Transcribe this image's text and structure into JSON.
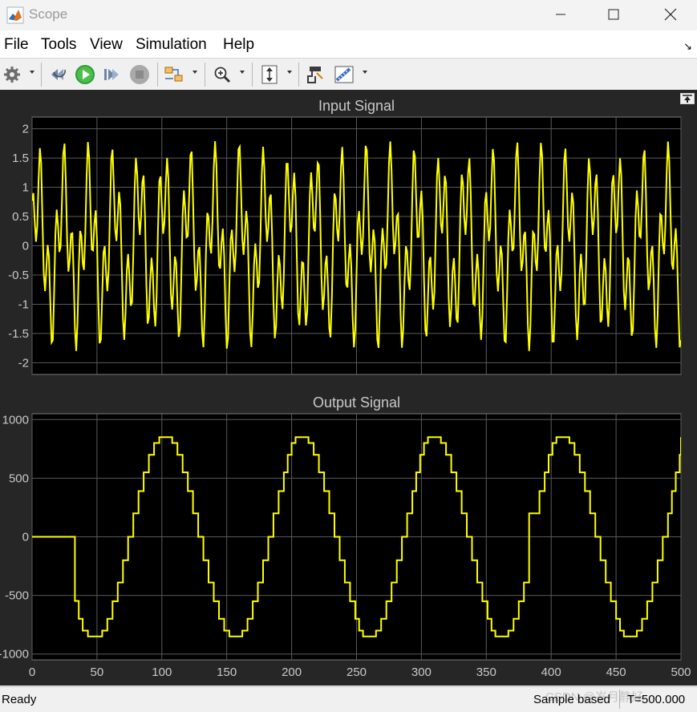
{
  "window": {
    "title": "Scope"
  },
  "menu": {
    "file": "File",
    "tools": "Tools",
    "view": "View",
    "simulation": "Simulation",
    "help": "Help"
  },
  "toolbar": {
    "icons": [
      "gear-icon",
      "step-back-icon",
      "run-icon",
      "step-forward-icon",
      "stop-icon",
      "signal-selector-icon",
      "zoom-icon",
      "autoscale-icon",
      "highlight-block-icon",
      "measurements-icon"
    ]
  },
  "status": {
    "ready": "Ready",
    "mode": "Sample based",
    "time": "T=500.000"
  },
  "watermark": "CSDN @岁月静好",
  "colors": {
    "plot_background": "#000000",
    "figure_background": "#262626",
    "line": "#ffff00",
    "grid": "#5a5a5a",
    "text": "#c8c8c8"
  },
  "chart_data": [
    {
      "type": "line",
      "title": "Input Signal",
      "xlabel": "",
      "ylabel": "",
      "xlim": [
        0,
        500
      ],
      "ylim": [
        -2.2,
        2.2
      ],
      "yticks": [
        -2,
        -1.5,
        -1,
        -0.5,
        0,
        0.5,
        1,
        1.5,
        2
      ],
      "ytick_labels": [
        "-2",
        "-1.5",
        "-1",
        "-0.5",
        "0",
        "0.5",
        "1",
        "1.5",
        "2"
      ],
      "xticks": [
        0,
        50,
        100,
        150,
        200,
        250,
        300,
        350,
        400,
        450,
        500
      ],
      "xtick_labels": [],
      "grid": true,
      "series": [
        {
          "color": "#ffff00",
          "x_start": 0,
          "x_step": 1,
          "x_end": 500,
          "frequencies": [
            0.12,
            0.38
          ],
          "amplitudes": [
            1.0,
            0.8
          ],
          "approx_range": [
            -1.8,
            1.8
          ]
        }
      ]
    },
    {
      "type": "line",
      "title": "Output Signal",
      "xlabel": "",
      "ylabel": "",
      "xlim": [
        0,
        500
      ],
      "ylim": [
        -1050,
        1050
      ],
      "yticks": [
        -1000,
        -500,
        0,
        500,
        1000
      ],
      "ytick_labels": [
        "-1000",
        "-500",
        "0",
        "500",
        "1000"
      ],
      "xticks": [
        0,
        50,
        100,
        150,
        200,
        250,
        300,
        350,
        400,
        450,
        500
      ],
      "xtick_labels": [
        "0",
        "50",
        "100",
        "150",
        "200",
        "250",
        "300",
        "350",
        "400",
        "450",
        "500"
      ],
      "grid": true,
      "series": [
        {
          "color": "#ffff00",
          "points": [
            [
              0,
              0
            ],
            [
              5,
              0
            ],
            [
              33,
              -547
            ],
            [
              36,
              -700
            ],
            [
              39,
              -800
            ],
            [
              43,
              -850
            ],
            [
              50,
              -850
            ],
            [
              54,
              -800
            ],
            [
              58,
              -700
            ],
            [
              62,
              -550
            ],
            [
              66,
              -390
            ],
            [
              70,
              -200
            ],
            [
              74,
              0
            ],
            [
              78,
              200
            ],
            [
              82,
              390
            ],
            [
              86,
              550
            ],
            [
              90,
              700
            ],
            [
              94,
              800
            ],
            [
              98,
              850
            ],
            [
              104,
              850
            ],
            [
              108,
              800
            ],
            [
              112,
              700
            ],
            [
              116,
              550
            ],
            [
              120,
              390
            ],
            [
              124,
              200
            ],
            [
              128,
              0
            ],
            [
              132,
              -200
            ],
            [
              136,
              -390
            ],
            [
              140,
              -550
            ],
            [
              144,
              -700
            ],
            [
              148,
              -800
            ],
            [
              152,
              -850
            ],
            [
              158,
              -850
            ],
            [
              162,
              -800
            ],
            [
              166,
              -700
            ],
            [
              170,
              -550
            ],
            [
              174,
              -390
            ],
            [
              178,
              -200
            ],
            [
              182,
              0
            ],
            [
              186,
              200
            ],
            [
              190,
              390
            ],
            [
              194,
              550
            ],
            [
              197,
              700
            ],
            [
              200,
              800
            ],
            [
              203,
              850
            ],
            [
              209,
              850
            ],
            [
              213,
              800
            ],
            [
              217,
              700
            ],
            [
              221,
              550
            ],
            [
              225,
              390
            ],
            [
              229,
              200
            ],
            [
              233,
              0
            ],
            [
              237,
              -200
            ],
            [
              241,
              -390
            ],
            [
              245,
              -550
            ],
            [
              249,
              -700
            ],
            [
              252,
              -800
            ],
            [
              255,
              -850
            ],
            [
              261,
              -850
            ],
            [
              265,
              -800
            ],
            [
              269,
              -700
            ],
            [
              273,
              -550
            ],
            [
              277,
              -390
            ],
            [
              281,
              -200
            ],
            [
              285,
              0
            ],
            [
              289,
              200
            ],
            [
              293,
              390
            ],
            [
              296,
              550
            ],
            [
              299,
              700
            ],
            [
              302,
              800
            ],
            [
              305,
              850
            ],
            [
              311,
              850
            ],
            [
              315,
              800
            ],
            [
              319,
              700
            ],
            [
              323,
              550
            ],
            [
              327,
              390
            ],
            [
              331,
              200
            ],
            [
              335,
              0
            ],
            [
              339,
              -200
            ],
            [
              343,
              -390
            ],
            [
              347,
              -550
            ],
            [
              351,
              -700
            ],
            [
              354,
              -800
            ],
            [
              357,
              -850
            ],
            [
              363,
              -850
            ],
            [
              367,
              -800
            ],
            [
              371,
              -700
            ],
            [
              375,
              -550
            ],
            [
              379,
              -390
            ],
            [
              383,
              200
            ],
            [
              387,
              200
            ],
            [
              391,
              390
            ],
            [
              395,
              550
            ],
            [
              398,
              700
            ],
            [
              401,
              800
            ],
            [
              404,
              850
            ],
            [
              410,
              850
            ],
            [
              414,
              800
            ],
            [
              418,
              700
            ],
            [
              422,
              550
            ],
            [
              426,
              390
            ],
            [
              430,
              200
            ],
            [
              434,
              0
            ],
            [
              438,
              -200
            ],
            [
              442,
              -390
            ],
            [
              446,
              -550
            ],
            [
              450,
              -700
            ],
            [
              453,
              -800
            ],
            [
              456,
              -850
            ],
            [
              462,
              -850
            ],
            [
              466,
              -800
            ],
            [
              470,
              -700
            ],
            [
              474,
              -550
            ],
            [
              478,
              -390
            ],
            [
              482,
              -200
            ],
            [
              486,
              0
            ],
            [
              490,
              200
            ],
            [
              493,
              390
            ],
            [
              496,
              550
            ],
            [
              499,
              700
            ],
            [
              500,
              850
            ]
          ]
        }
      ]
    }
  ]
}
